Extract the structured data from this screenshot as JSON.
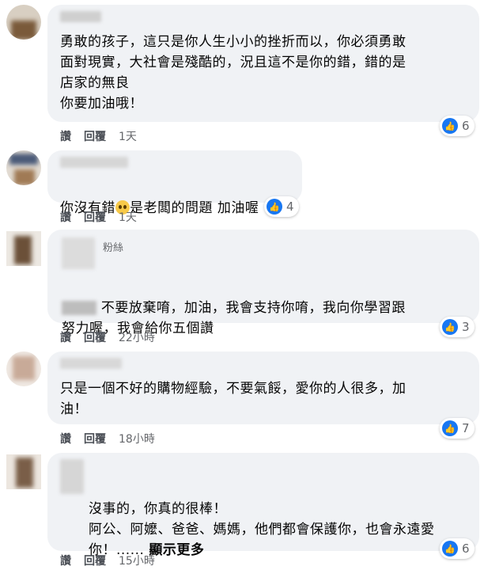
{
  "labels": {
    "like": "讚",
    "reply": "回覆"
  },
  "comments": [
    {
      "text": "勇敢的孩子，這只是你人生小小的挫折而以，你必須勇敢\n面對現實，大社會是殘酷的，況且這不是你的錯，錯的是\n店家的無良\n你要加油哦！",
      "time": "1天",
      "reactions": "6"
    },
    {
      "text_before": "你沒有錯",
      "text_after": "是老闆的問題 加油喔",
      "time": "1天",
      "reactions": "4"
    },
    {
      "badge": "粉絲",
      "text": "不要放棄唷，加油，我會支持你唷，我向你學習跟\n努力喔，我會給你五個讚",
      "time": "22小時",
      "reactions": "3"
    },
    {
      "text": "只是一個不好的購物經驗，不要氣餒，愛你的人很多，加\n油！",
      "time": "18小時",
      "reactions": "7"
    },
    {
      "text": "沒事的，你真的很棒！\n阿公、阿嬤、爸爸、媽媽，他們都會保護你，也會永遠愛\n你！......",
      "see_more": "顯示更多",
      "time": "15小時",
      "reactions": "6"
    }
  ],
  "icons": {
    "like": "thumbs-up-icon",
    "emoji": "pleading-face-emoji"
  },
  "colors": {
    "bubble": "#f0f2f5",
    "like_blue": "#1877f2",
    "meta": "#65676b"
  }
}
